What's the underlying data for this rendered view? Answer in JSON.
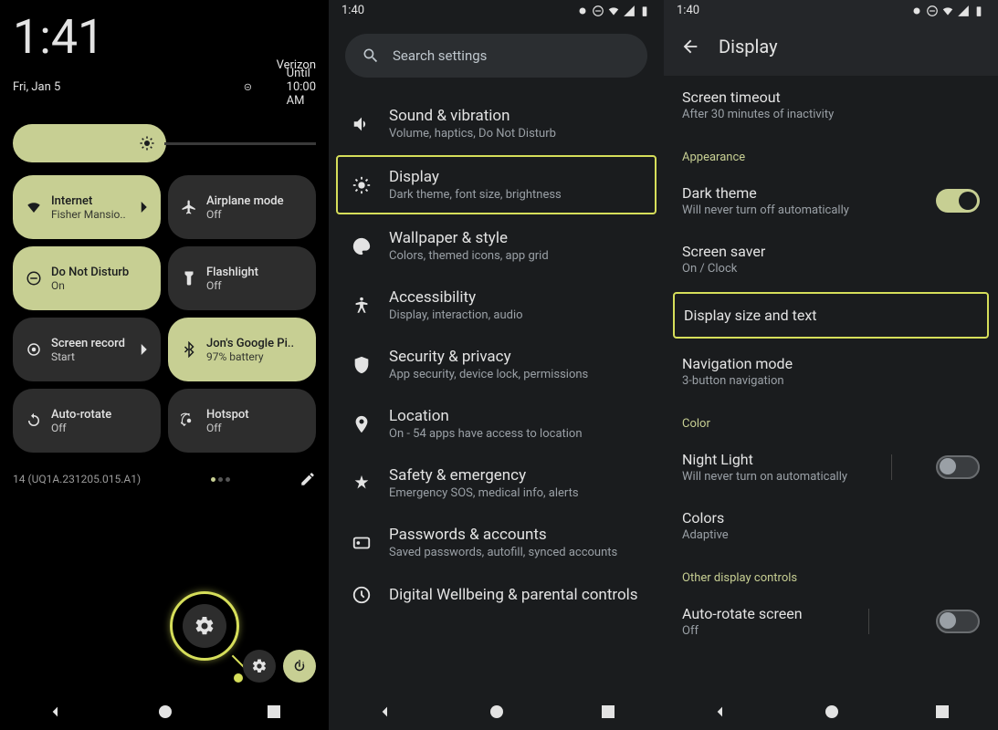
{
  "screen1": {
    "time": "1:41",
    "carrier": "Verizon",
    "date": "Fri, Jan 5",
    "until": "Until 10:00 AM",
    "tiles": [
      {
        "title": "Internet",
        "sub": "Fisher Mansio..",
        "active": true,
        "icon": "wifi",
        "chevron": true
      },
      {
        "title": "Airplane mode",
        "sub": "Off",
        "active": false,
        "icon": "airplane"
      },
      {
        "title": "Do Not Disturb",
        "sub": "On",
        "active": true,
        "icon": "dnd"
      },
      {
        "title": "Flashlight",
        "sub": "Off",
        "active": false,
        "icon": "flashlight"
      },
      {
        "title": "Screen record",
        "sub": "Start",
        "active": false,
        "icon": "record",
        "chevron": true
      },
      {
        "title": "Jon's Google Pi..",
        "sub": "97% battery",
        "active": true,
        "icon": "bluetooth"
      },
      {
        "title": "Auto-rotate",
        "sub": "Off",
        "active": false,
        "icon": "rotate"
      },
      {
        "title": "Hotspot",
        "sub": "Off",
        "active": false,
        "icon": "hotspot"
      }
    ],
    "build": "14 (UQ1A.231205.015.A1)"
  },
  "screen2": {
    "status_time": "1:40",
    "search_placeholder": "Search settings",
    "items": [
      {
        "title": "Sound & vibration",
        "sub": "Volume, haptics, Do Not Disturb",
        "icon": "volume"
      },
      {
        "title": "Display",
        "sub": "Dark theme, font size, brightness",
        "icon": "brightness",
        "highlight": true
      },
      {
        "title": "Wallpaper & style",
        "sub": "Colors, themed icons, app grid",
        "icon": "palette"
      },
      {
        "title": "Accessibility",
        "sub": "Display, interaction, audio",
        "icon": "accessibility"
      },
      {
        "title": "Security & privacy",
        "sub": "App security, device lock, permissions",
        "icon": "shield"
      },
      {
        "title": "Location",
        "sub": "On - 54 apps have access to location",
        "icon": "location"
      },
      {
        "title": "Safety & emergency",
        "sub": "Emergency SOS, medical info, alerts",
        "icon": "emergency"
      },
      {
        "title": "Passwords & accounts",
        "sub": "Saved passwords, autofill, synced accounts",
        "icon": "key"
      },
      {
        "title": "Digital Wellbeing & parental controls",
        "sub": "",
        "icon": "wellbeing"
      }
    ]
  },
  "screen3": {
    "status_time": "1:40",
    "header": "Display",
    "screen_timeout": {
      "title": "Screen timeout",
      "sub": "After 30 minutes of inactivity"
    },
    "appearance_label": "Appearance",
    "dark_theme": {
      "title": "Dark theme",
      "sub": "Will never turn off automatically",
      "on": true
    },
    "screen_saver": {
      "title": "Screen saver",
      "sub": "On / Clock"
    },
    "display_size": {
      "title": "Display size and text",
      "highlight": true
    },
    "nav_mode": {
      "title": "Navigation mode",
      "sub": "3-button navigation"
    },
    "color_label": "Color",
    "night_light": {
      "title": "Night Light",
      "sub": "Will never turn on automatically",
      "on": false
    },
    "colors": {
      "title": "Colors",
      "sub": "Adaptive"
    },
    "other_label": "Other display controls",
    "auto_rotate": {
      "title": "Auto-rotate screen",
      "sub": "Off",
      "on": false
    }
  }
}
